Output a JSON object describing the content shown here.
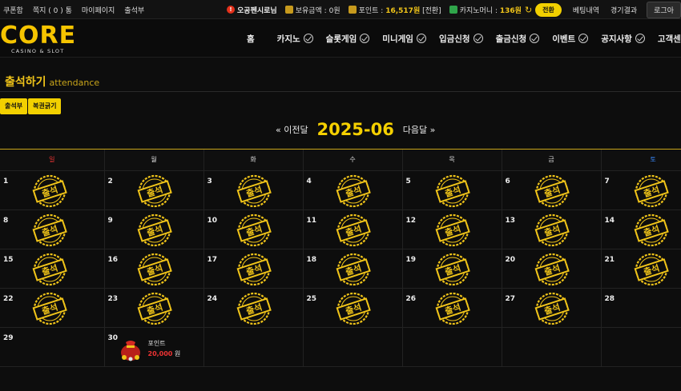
{
  "topbar": {
    "left_links": [
      "쿠폰함",
      "쪽지 ( 0 ) 통",
      "마이페이지",
      "출석부"
    ],
    "username": "오공펜시로님",
    "balance_label": "보유금액 :",
    "balance_value": "0원",
    "point_label": "포인트 :",
    "point_value": "16,517원",
    "point_convert": "[전환]",
    "casino_label": "카지노머니 :",
    "casino_value": "136원",
    "convert_button": "전환",
    "betting_history": "베팅내역",
    "game_results": "경기결과",
    "login_button": "로그아"
  },
  "logo": {
    "main": "CORE",
    "sub": "CASINO & SLOT"
  },
  "nav": [
    "홈",
    "카지노",
    "슬롯게임",
    "미니게임",
    "입금신청",
    "출금신청",
    "이벤트",
    "공지사항",
    "고객센"
  ],
  "page": {
    "title": "출석하기",
    "title_en": "attendance"
  },
  "sub_buttons": [
    "출석부",
    "복권긁기"
  ],
  "month": {
    "prev": "« 이전달",
    "current": "2025-06",
    "next": "다음달 »"
  },
  "calendar": {
    "weekdays": [
      "일",
      "월",
      "화",
      "수",
      "목",
      "금",
      "토"
    ],
    "weeks": [
      [
        1,
        2,
        3,
        4,
        5,
        6,
        7
      ],
      [
        8,
        9,
        10,
        11,
        12,
        13,
        14
      ],
      [
        15,
        16,
        17,
        18,
        19,
        20,
        21
      ],
      [
        22,
        23,
        24,
        25,
        26,
        27,
        28
      ],
      [
        29,
        30,
        null,
        null,
        null,
        null,
        null
      ]
    ],
    "attended_days": [
      1,
      2,
      3,
      4,
      5,
      6,
      7,
      8,
      9,
      10,
      11,
      12,
      13,
      14,
      15,
      16,
      17,
      18,
      19,
      20,
      21,
      22,
      23,
      24,
      25,
      26,
      27
    ],
    "stamp_text": "출석",
    "reward_day": 30,
    "reward_label": "포인트",
    "reward_amount": "20,000",
    "reward_unit": "원"
  },
  "colors": {
    "accent": "#f2d000",
    "sunday": "#e33333",
    "saturday": "#3a8bff"
  }
}
